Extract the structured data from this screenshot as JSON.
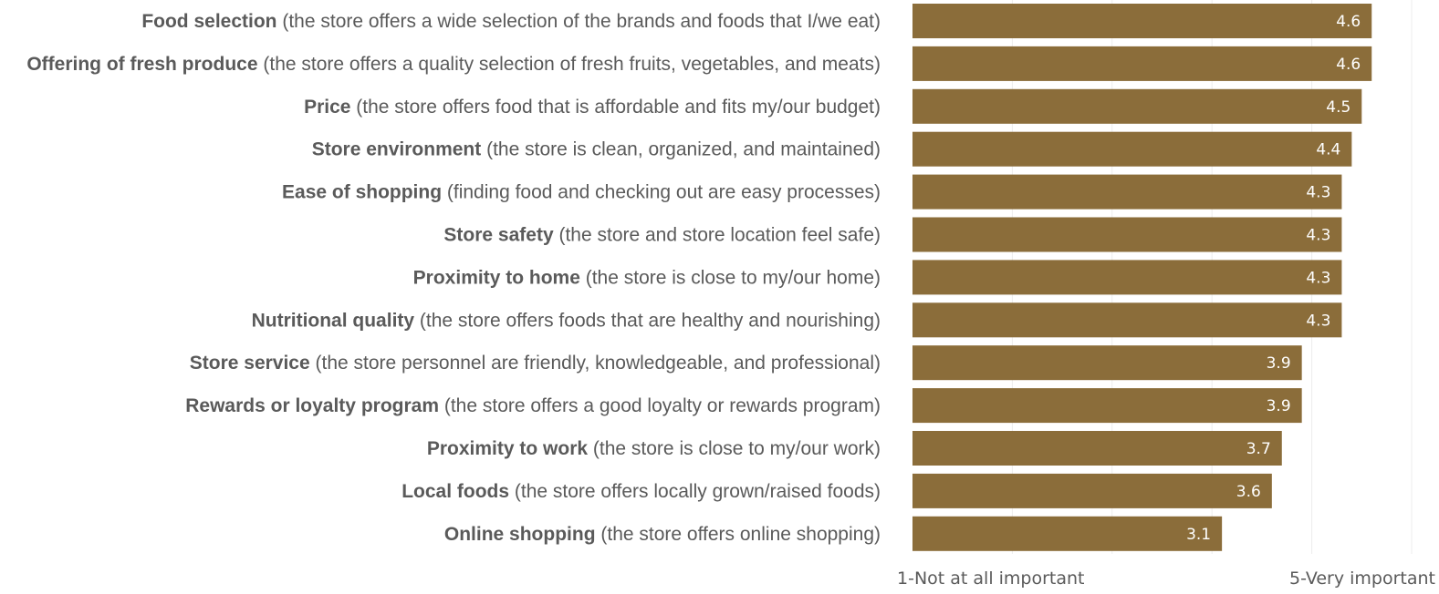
{
  "chart_data": {
    "type": "bar",
    "orientation": "horizontal",
    "categories": [
      {
        "name": "Food selection",
        "description": "(the store offers a wide selection of the brands and foods that I/we eat)"
      },
      {
        "name": "Offering of fresh produce",
        "description": "(the store offers a quality selection of fresh fruits, vegetables, and meats)"
      },
      {
        "name": "Price",
        "description": "(the store offers food that is affordable and fits my/our budget)"
      },
      {
        "name": "Store environment",
        "description": "(the store is clean, organized, and maintained)"
      },
      {
        "name": "Ease of shopping",
        "description": "(finding food and checking out are easy processes)"
      },
      {
        "name": "Store safety",
        "description": "(the store and store location feel safe)"
      },
      {
        "name": "Proximity to home",
        "description": "(the store is close to my/our home)"
      },
      {
        "name": "Nutritional quality",
        "description": "(the store offers foods that are healthy and nourishing)"
      },
      {
        "name": "Store service",
        "description": "(the store personnel are friendly, knowledgeable, and professional)"
      },
      {
        "name": "Rewards or loyalty program",
        "description": "(the store offers a good loyalty or rewards program)"
      },
      {
        "name": "Proximity to work",
        "description": "(the store is close to my/our work)"
      },
      {
        "name": "Local foods",
        "description": "(the store offers locally grown/raised foods)"
      },
      {
        "name": "Online shopping",
        "description": "(the store offers online shopping)"
      }
    ],
    "values": [
      4.6,
      4.6,
      4.5,
      4.4,
      4.3,
      4.3,
      4.3,
      4.3,
      3.9,
      3.9,
      3.7,
      3.6,
      3.1
    ],
    "value_labels": [
      "4.6",
      "4.6",
      "4.5",
      "4.4",
      "4.3",
      "4.3",
      "4.3",
      "4.3",
      "3.9",
      "3.9",
      "3.7",
      "3.6",
      "3.1"
    ],
    "axis_min_label": "1-Not at all important",
    "axis_max_label": "5-Very important",
    "xlim": [
      0,
      5
    ],
    "grid": true,
    "bar_color": "#8b6d3a",
    "grid_color": "#ececec",
    "label_color": "#5a5a5a",
    "value_label_color": "#ffffff"
  }
}
